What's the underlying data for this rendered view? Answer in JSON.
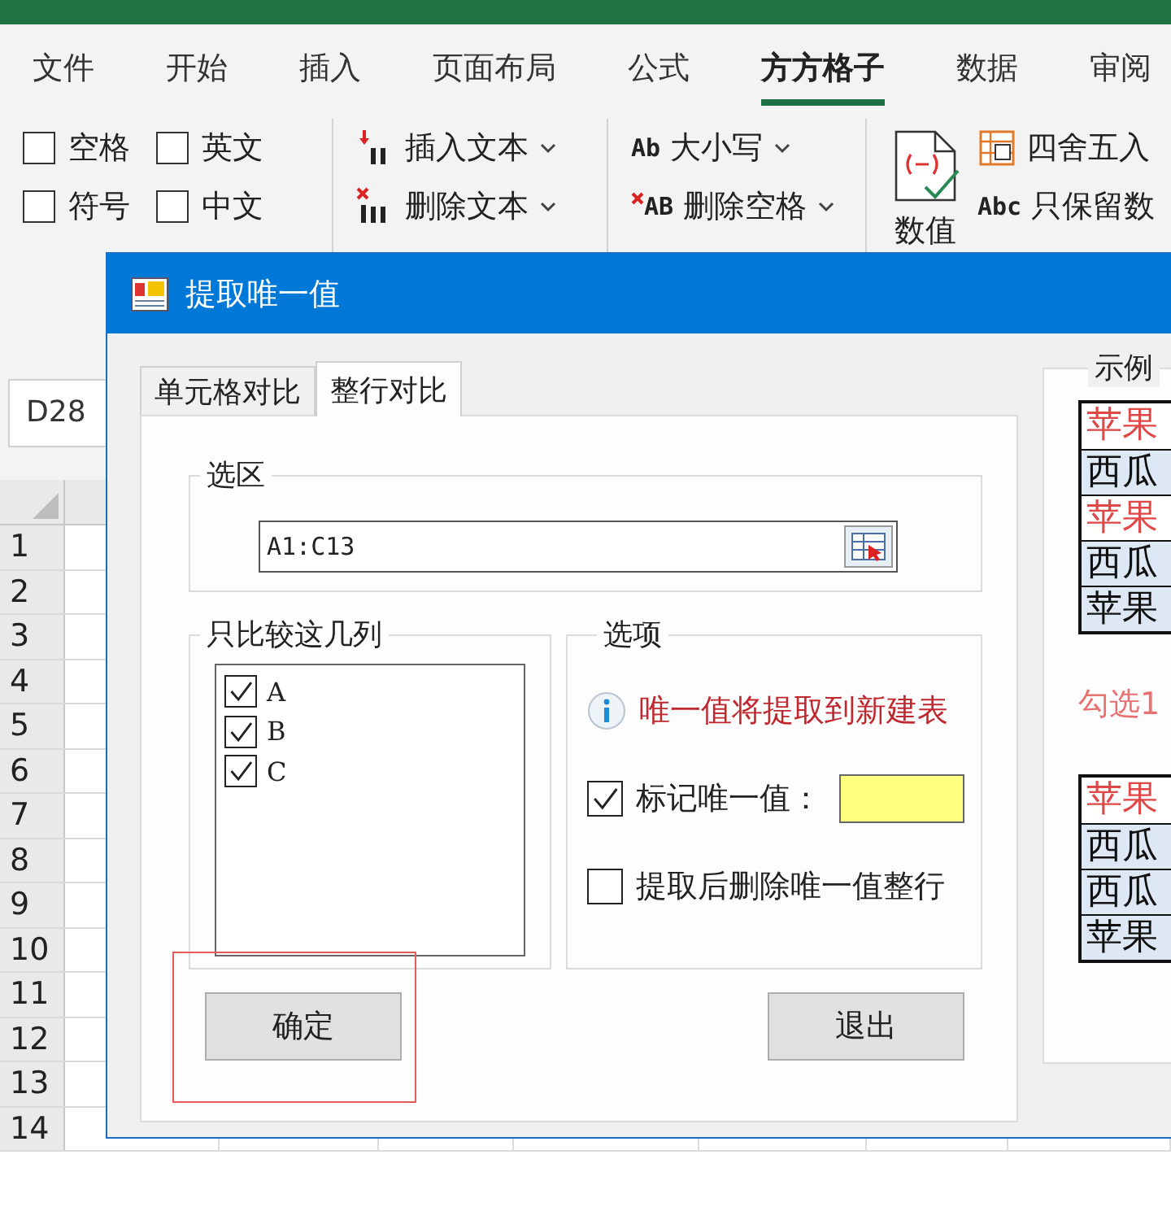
{
  "ribbon": {
    "tabs": [
      {
        "label": "文件",
        "selected": false
      },
      {
        "label": "开始",
        "selected": false
      },
      {
        "label": "插入",
        "selected": false
      },
      {
        "label": "页面布局",
        "selected": false
      },
      {
        "label": "公式",
        "selected": false
      },
      {
        "label": "方方格子",
        "selected": true
      },
      {
        "label": "数据",
        "selected": false
      },
      {
        "label": "审阅",
        "selected": false
      }
    ],
    "checkboxes": [
      {
        "label": "空格",
        "checked": false
      },
      {
        "label": "英文",
        "checked": false
      },
      {
        "label": "符号",
        "checked": false
      },
      {
        "label": "中文",
        "checked": false
      }
    ],
    "command_groups": [
      [
        {
          "kind": "insert",
          "label": "插入文本",
          "dropdown": true
        },
        {
          "kind": "delete",
          "label": "删除文本",
          "dropdown": true
        }
      ],
      [
        {
          "kind": "case",
          "icon_text": "Ab",
          "label": "大小写",
          "dropdown": true
        },
        {
          "kind": "trim",
          "icon_text": "AB",
          "label": "删除空格",
          "dropdown": true
        }
      ]
    ],
    "big_button": {
      "label": "数值"
    },
    "small_commands": [
      {
        "kind": "round",
        "label": "四舍五入"
      },
      {
        "kind": "keep",
        "icon_text": "Abc",
        "label": "只保留数"
      }
    ]
  },
  "sheet": {
    "name_box": "D28",
    "rows": [
      "1",
      "2",
      "3",
      "4",
      "5",
      "6",
      "7",
      "8",
      "9",
      "10",
      "11",
      "12",
      "13",
      "14"
    ]
  },
  "dialog": {
    "title": "提取唯一值",
    "tabs": [
      {
        "label": "单元格对比",
        "selected": false
      },
      {
        "label": "整行对比",
        "selected": true
      }
    ],
    "range": {
      "legend": "选区",
      "value": "A1:C13"
    },
    "columns": {
      "legend": "只比较这几列",
      "items": [
        {
          "label": "A",
          "checked": true
        },
        {
          "label": "B",
          "checked": true
        },
        {
          "label": "C",
          "checked": true
        }
      ]
    },
    "options": {
      "legend": "选项",
      "info": "唯一值将提取到新建表",
      "items": [
        {
          "kind": "swatch",
          "label": "标记唯一值：",
          "checked": true,
          "color": "#ffff80"
        },
        {
          "kind": "plain",
          "label": "提取后删除唯一值整行",
          "checked": false
        }
      ]
    },
    "buttons": [
      {
        "label": "确定",
        "highlighted": true
      },
      {
        "label": "退出",
        "highlighted": false
      }
    ],
    "example": {
      "legend": "示例",
      "sections": [
        {
          "kind": "table",
          "rows": [
            {
              "text": "苹果",
              "unique": true
            },
            {
              "text": "西瓜",
              "unique": false
            },
            {
              "text": "苹果",
              "unique": true
            },
            {
              "text": "西瓜",
              "unique": false
            },
            {
              "text": "苹果",
              "unique": false
            }
          ]
        },
        {
          "kind": "note",
          "text": "勾选1"
        },
        {
          "kind": "table",
          "rows": [
            {
              "text": "苹果",
              "unique": true
            },
            {
              "text": "西瓜",
              "unique": false
            },
            {
              "text": "西瓜",
              "unique": false
            },
            {
              "text": "苹果",
              "unique": false
            }
          ]
        }
      ]
    }
  }
}
